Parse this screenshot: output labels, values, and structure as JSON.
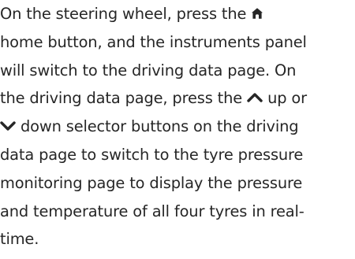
{
  "paragraph": {
    "line1_a": "On the steering wheel, press the",
    "line2": "home button, and the instruments panel",
    "line3": "will switch to the driving data page. On",
    "line4_a": "the driving data page, press the",
    "line4_b": "up or",
    "line5": "down selector buttons on the driving",
    "line6": "data page to switch to the tyre pressure",
    "line7": "monitoring page to display the pressure",
    "line8": "and temperature of all four tyres in real-",
    "line9": "time."
  },
  "icons": {
    "home": "home-icon",
    "up": "chevron-up-icon",
    "down": "chevron-down-icon"
  }
}
